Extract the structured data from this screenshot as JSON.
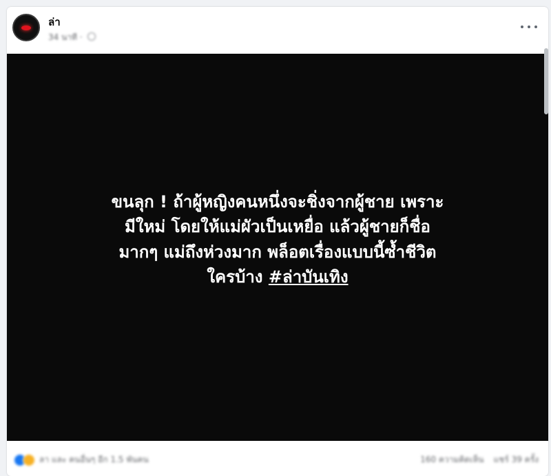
{
  "post": {
    "page_name": "ล่า",
    "meta_time": "34 นาที ·",
    "text_lines": [
      "ขนลุก ! ถ้าผู้หญิงคนหนึ่งจะชิ่งจากผู้ชาย เพราะ",
      "มีใหม่ โดยให้แม่ผัวเป็นเหยื่อ แล้วผู้ชายก็ชื่อ",
      "มากๆ แม่ถึงห่วงมาก พล็อตเรื่องแบบนี้ซ้ำชีวิต"
    ],
    "text_last_prefix": "ใครบ้าง ",
    "hashtag": "#ล่าบันเทิง"
  },
  "footer": {
    "reactions_summary": "ลา และ คนอื่นๆ อีก 1.5 พันคน",
    "comments": "160 ความคิดเห็น",
    "shares": "แชร์ 39 ครั้ง"
  },
  "icons": {
    "more": "more-icon",
    "privacy": "globe-icon",
    "reaction_like": "like-icon",
    "reaction_haha": "haha-icon"
  },
  "colors": {
    "media_background": "#0a0a0a",
    "text": "#ffffff",
    "page_background": "#f0f2f5"
  }
}
